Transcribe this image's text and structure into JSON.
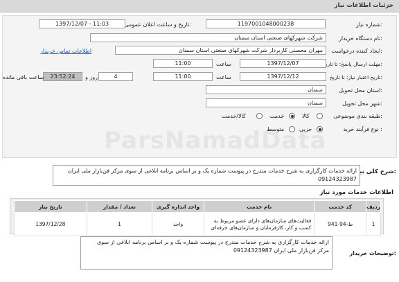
{
  "header": {
    "title": "جزئیات اطلاعات نیاز"
  },
  "form": {
    "need_number_label": "شماره نیاز:",
    "need_number": "1197001048000238",
    "announce_label": "تاریخ و ساعت اعلان عمومی:",
    "announce_value": "1397/12/07 - 11:03",
    "buyer_label": "نام دستگاه خریدار:",
    "buyer_value": "شرکت شهرکهای صنعتی استان سمنان",
    "creator_label": "ایجاد کننده درخواست:",
    "creator_value": "مهران محسنی کاربردار شرکت شهرکهای صنعتی استان سمنان",
    "contact_link": "اطلاعات تماس خریدار",
    "send_deadline_label": "مهلت ارسال پاسخ: تا تاریخ:",
    "send_date": "1397/12/07",
    "time_label": "ساعت",
    "send_time": "11:00",
    "validity_label": "تاریخ اعتبار نیاز: تا تاریخ:",
    "validity_date": "1397/12/12",
    "validity_time": "11:00",
    "days_value": "4",
    "days_label": "روز و",
    "remaining_time": "23:52:24",
    "remaining_label": "ساعت باقی مانده",
    "province_label": "استان محل تحویل:",
    "province_value": "سمنان",
    "city_label": "شهر محل تحویل:",
    "city_value": "سمنان",
    "category_label": "طبقه بندی موضوعی:",
    "category_options": [
      "کالا",
      "خدمت",
      "کالا/خدمت"
    ],
    "category_selected": "خدمت",
    "process_label": "نوع فرآیند خرید :",
    "process_options": [
      "جزیی",
      "متوسط"
    ],
    "process_selected": "جزیی"
  },
  "summary": {
    "label": "شرح کلی نیاز:",
    "text": "ارائه خدمات کارگزاری به شرح خدمات مندرج در پیوست شماره یک و بر اساس برنامه ابلاغی از سوی مرکز فن‌بازار ملی ایران 09124323987"
  },
  "services": {
    "title": "اطلاعات خدمات مورد نیاز",
    "columns": [
      "ردیف",
      "کد خدمت",
      "نام خدمت",
      "واحد اندازه گیری",
      "تعداد / مقدار",
      "تاریخ نیاز"
    ],
    "rows": [
      {
        "row": "1",
        "code": "ط-94-941",
        "name": "فعالیت‌های سازمان‌های دارای عضو مربوط به کسب و کار، کارفرمایان و سازمان‌های حرفه‌ای",
        "unit": "واحد",
        "qty": "1",
        "date": "1397/12/28"
      }
    ]
  },
  "notes": {
    "label": "توضیحات خریدار:",
    "text": "ارائه خدمات کارگزاری به شرح خدمات مندرج در پیوست شماره یک و بر اساس برنامه ابلاغی از سوی مرکز فن‌بازار ملی ایران 09124323987"
  },
  "watermark": "ParsNamadData"
}
